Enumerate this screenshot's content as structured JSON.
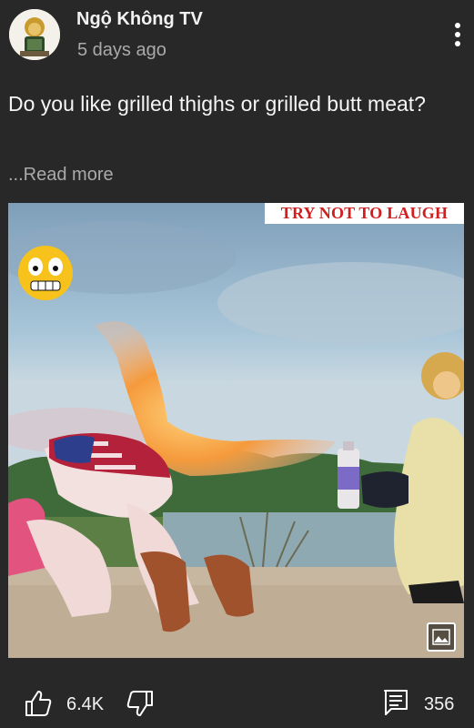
{
  "post": {
    "channel_name": "Ngộ Không TV",
    "timestamp": "5 days ago",
    "text": "Do you like grilled thighs or grilled butt meat?",
    "read_more": "...Read more"
  },
  "image": {
    "banner_text": "TRY NOT TO LAUGH",
    "banner_color": "#d21e1e"
  },
  "actions": {
    "like_count": "6.4K",
    "comment_count": "356"
  },
  "icons": {
    "menu": "more-vert-icon",
    "like": "thumbs-up-icon",
    "dislike": "thumbs-down-icon",
    "comments": "comment-icon",
    "gallery": "image-icon"
  },
  "colors": {
    "background": "#282828",
    "primary_text": "#f5f5f5",
    "secondary_text": "#aaaaaa"
  }
}
